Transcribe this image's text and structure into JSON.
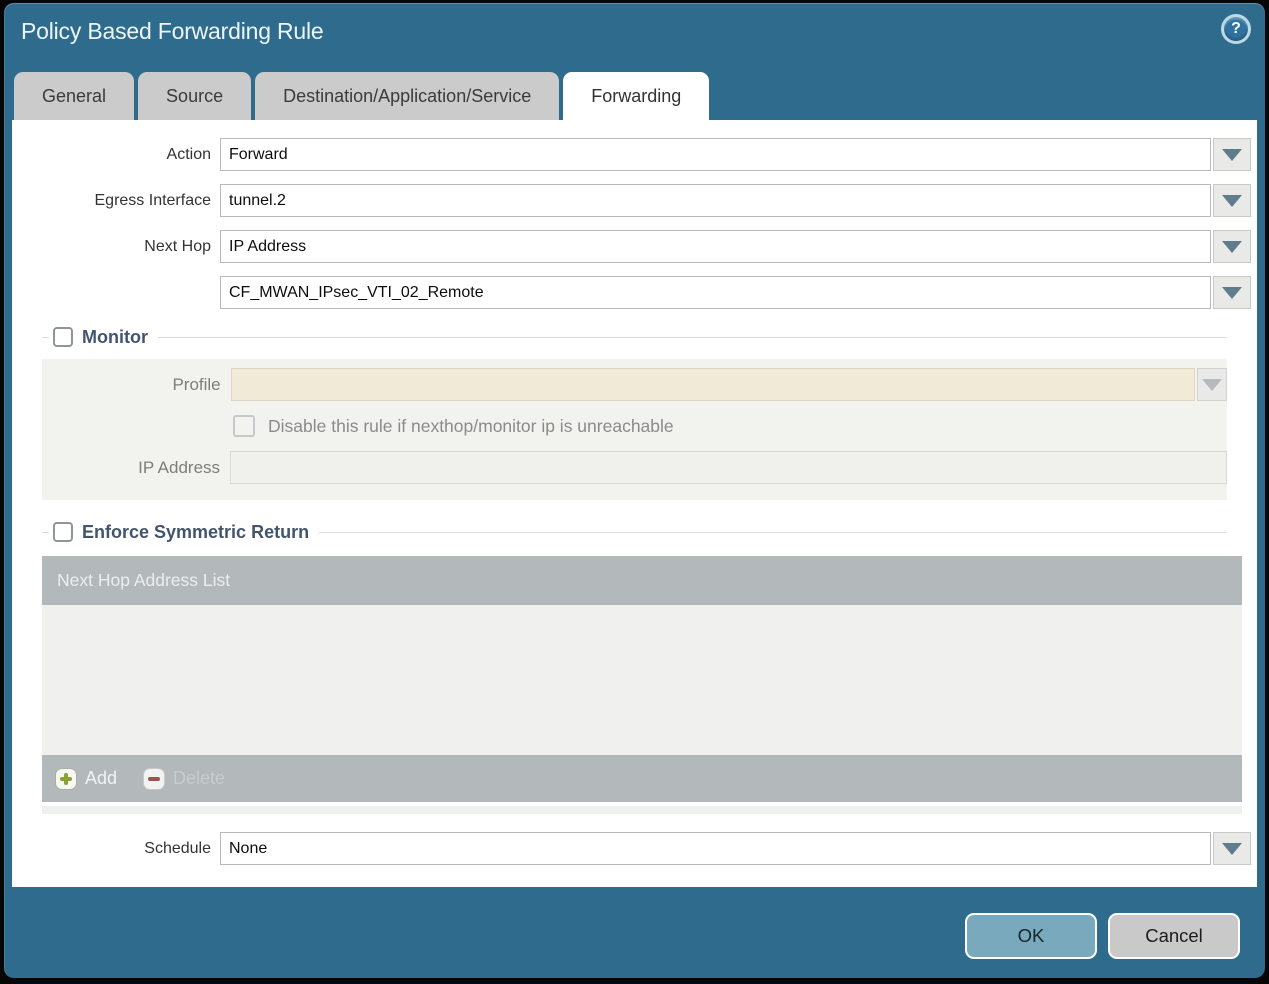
{
  "dialog": {
    "title": "Policy Based Forwarding Rule",
    "help_icon_glyph": "?"
  },
  "tabs": [
    {
      "label": "General",
      "active": false
    },
    {
      "label": "Source",
      "active": false
    },
    {
      "label": "Destination/Application/Service",
      "active": false
    },
    {
      "label": "Forwarding",
      "active": true
    }
  ],
  "form": {
    "action": {
      "label": "Action",
      "value": "Forward"
    },
    "egress_interface": {
      "label": "Egress Interface",
      "value": "tunnel.2"
    },
    "next_hop": {
      "label": "Next Hop",
      "value": "IP Address"
    },
    "next_hop_address": {
      "value": "CF_MWAN_IPsec_VTI_02_Remote"
    },
    "schedule": {
      "label": "Schedule",
      "value": "None"
    }
  },
  "monitor": {
    "title": "Monitor",
    "checked": false,
    "profile": {
      "label": "Profile",
      "value": ""
    },
    "disable_rule": {
      "label": "Disable this rule if nexthop/monitor ip is unreachable",
      "checked": false
    },
    "ip_address": {
      "label": "IP Address",
      "value": ""
    }
  },
  "enforce_symmetric_return": {
    "title": "Enforce Symmetric Return",
    "checked": false,
    "table": {
      "header": "Next Hop Address List",
      "rows": []
    },
    "add_label": "Add",
    "delete_label": "Delete"
  },
  "buttons": {
    "ok": "OK",
    "cancel": "Cancel"
  },
  "colors": {
    "dialog_teal": "#2e6b8c",
    "tab_gray": "#cbcbcb",
    "panel_gray": "#f2f2ef",
    "disabled_beige": "#f0ead6",
    "table_bar_gray": "#b3b8bb",
    "table_body": "#f0f0ee",
    "ok_button": "#79a9bc",
    "cancel_button": "#c9c9c9",
    "add_green": "#8aa231",
    "delete_red": "#a05252",
    "section_title": "#42556c"
  }
}
